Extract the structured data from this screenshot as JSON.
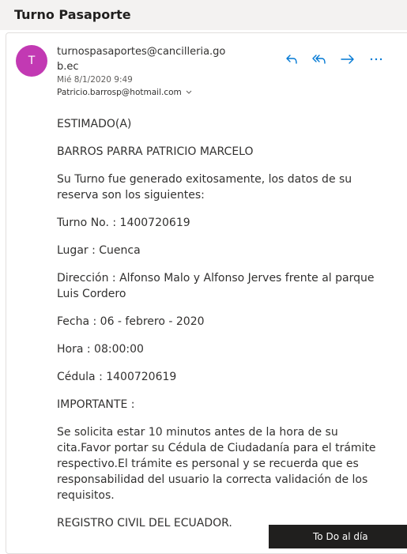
{
  "subject": "Turno Pasaporte",
  "sender": {
    "avatar_initial": "T",
    "avatar_color": "#c239b3",
    "address": "turnospasaportes@cancilleria.gob.ec",
    "date": "Mié 8/1/2020 9:49",
    "to": "Patricio.barrosp@hotmail.com"
  },
  "actions": {
    "reply_icon": "reply-icon",
    "reply_all_icon": "reply-all-icon",
    "forward_icon": "forward-icon",
    "more_icon": "more-icon",
    "accent_color": "#0078d4"
  },
  "body": {
    "p1": "ESTIMADO(A)",
    "p2": "BARROS PARRA PATRICIO MARCELO",
    "p3": "Su Turno fue generado exitosamente, los datos de su reserva son los siguientes:",
    "p4": "Turno No. : 1400720619",
    "p5": "Lugar : Cuenca",
    "p6": "Dirección : Alfonso Malo y Alfonso Jerves frente al parque Luis Cordero",
    "p7": "Fecha : 06 - febrero - 2020",
    "p8": "Hora : 08:00:00",
    "p9": "Cédula : 1400720619",
    "p10": "IMPORTANTE :",
    "p11": "Se solicita estar 10 minutos antes de la hora de su cita.Favor portar su Cédula de Ciudadanía para el trámite respectivo.El trámite es personal y se recuerda que es responsabilidad del usuario la correcta validación de los requisitos.",
    "p12": "REGISTRO CIVIL DEL ECUADOR."
  },
  "toast": {
    "text": "To Do al día"
  }
}
